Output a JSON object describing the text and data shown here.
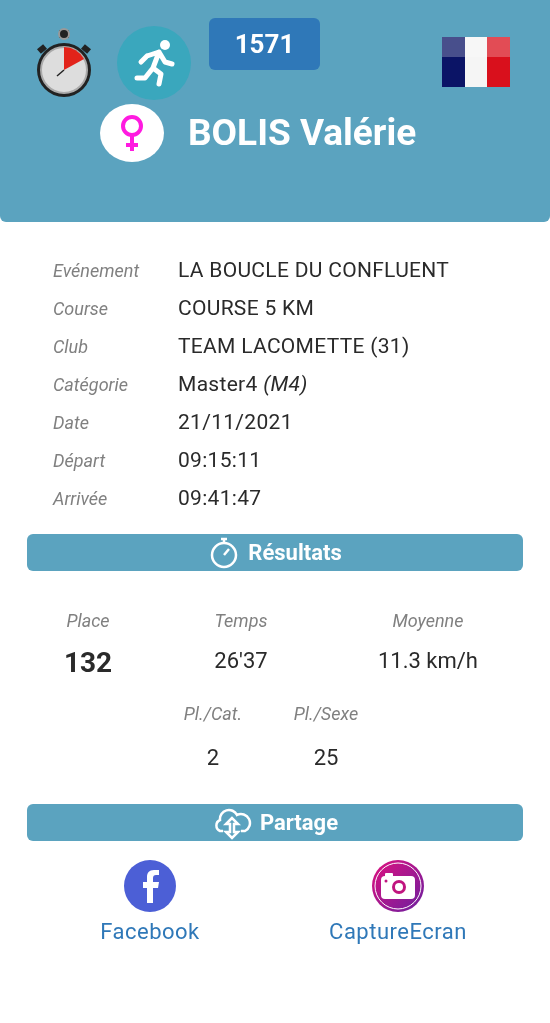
{
  "header": {
    "bib": "1571",
    "name": "BOLIS Valérie",
    "female": true
  },
  "details": [
    {
      "label": "Evénement",
      "value": "LA BOUCLE DU CONFLUENT"
    },
    {
      "label": "Course",
      "value": "COURSE 5 KM"
    },
    {
      "label": "Club",
      "value": "TEAM LACOMETTE (31)"
    },
    {
      "label": "Catégorie",
      "value": "Master4 *(M4)*"
    },
    {
      "label": "Date",
      "value": "21/11/2021"
    },
    {
      "label": "Départ",
      "value": "09:15:11"
    },
    {
      "label": "Arrivée",
      "value": "09:41:47"
    }
  ],
  "results": {
    "title": "Résultats",
    "main": [
      {
        "label": "Place",
        "value": "132",
        "bold": true
      },
      {
        "label": "Temps",
        "value": "26'37",
        "bold": false
      },
      {
        "label": "Moyenne",
        "value": "11.3 km/h",
        "bold": false
      }
    ],
    "secondary": [
      {
        "label": "Pl./Cat.",
        "value": "2"
      },
      {
        "label": "Pl./Sexe",
        "value": "25"
      }
    ]
  },
  "share": {
    "title": "Partage",
    "buttons": [
      {
        "kind": "facebook",
        "label": "Facebook"
      },
      {
        "kind": "screenshot",
        "label": "CaptureEcran"
      }
    ]
  }
}
